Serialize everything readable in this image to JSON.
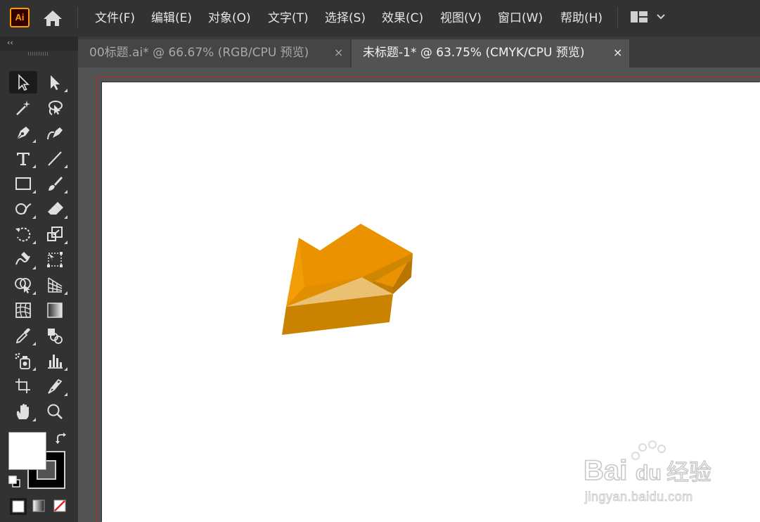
{
  "app": {
    "logo_text": "Ai"
  },
  "menu": [
    {
      "label": "文件(F)"
    },
    {
      "label": "编辑(E)"
    },
    {
      "label": "对象(O)"
    },
    {
      "label": "文字(T)"
    },
    {
      "label": "选择(S)"
    },
    {
      "label": "效果(C)"
    },
    {
      "label": "视图(V)"
    },
    {
      "label": "窗口(W)"
    },
    {
      "label": "帮助(H)"
    }
  ],
  "tabs": [
    {
      "label": "00标题.ai* @ 66.67% (RGB/CPU 预览)",
      "close": "×",
      "active": false
    },
    {
      "label": "未标题-1* @ 63.75% (CMYK/CPU 预览)",
      "close": "×",
      "active": true
    }
  ],
  "toolbar": {
    "collapse_glyph": "‹‹"
  },
  "tools": [
    "selection-tool",
    "direct-selection-tool",
    "magic-wand-tool",
    "lasso-tool",
    "pen-tool",
    "curvature-tool",
    "type-tool",
    "line-segment-tool",
    "rectangle-tool",
    "paintbrush-tool",
    "shaper-tool",
    "eraser-tool",
    "rotate-tool",
    "scale-tool",
    "warp-tool",
    "free-transform-tool",
    "shape-builder-tool",
    "perspective-grid-tool",
    "mesh-tool",
    "gradient-tool",
    "eyedropper-tool",
    "blend-tool",
    "symbol-sprayer-tool",
    "column-graph-tool",
    "artboard-tool",
    "slice-tool",
    "hand-tool",
    "zoom-tool"
  ],
  "colors": {
    "fill": "#ffffff",
    "stroke": "#000000",
    "accent": "#ff9a00",
    "arrow_top": "#ea9200",
    "arrow_front": "#c98300",
    "arrow_side": "#b97600"
  },
  "watermark": {
    "brand": "Bai",
    "brand_tail": "du",
    "suffix": "经验",
    "url": "jingyan.baidu.com"
  }
}
